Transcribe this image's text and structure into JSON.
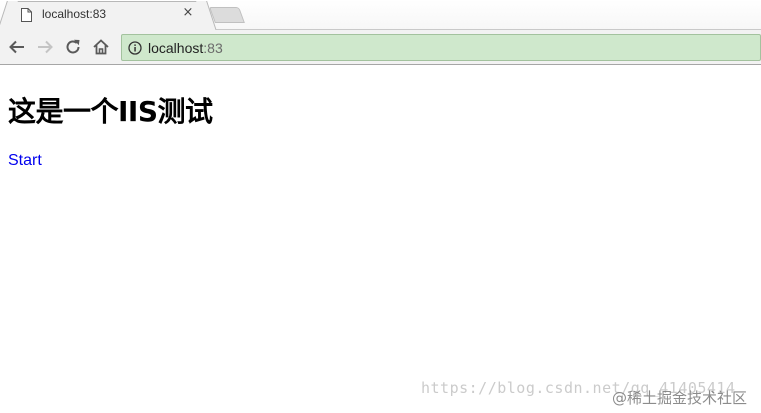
{
  "browser": {
    "tab": {
      "title": "localhost:83",
      "close_glyph": "×"
    },
    "address_bar": {
      "host": "localhost",
      "port": ":83"
    },
    "icons": {
      "back": "back-arrow-icon",
      "forward": "forward-arrow-icon",
      "reload": "reload-icon",
      "home": "home-icon",
      "info": "info-icon",
      "page": "page-icon"
    },
    "colors": {
      "address_bar_bg": "#cfe8cc",
      "link": "#0000ee"
    }
  },
  "page": {
    "heading": "这是一个IIS测试",
    "link_text": "Start"
  },
  "watermark": {
    "text": "https://blog.csdn.net/qq_41405414",
    "text2": "@稀土掘金技术社区"
  }
}
